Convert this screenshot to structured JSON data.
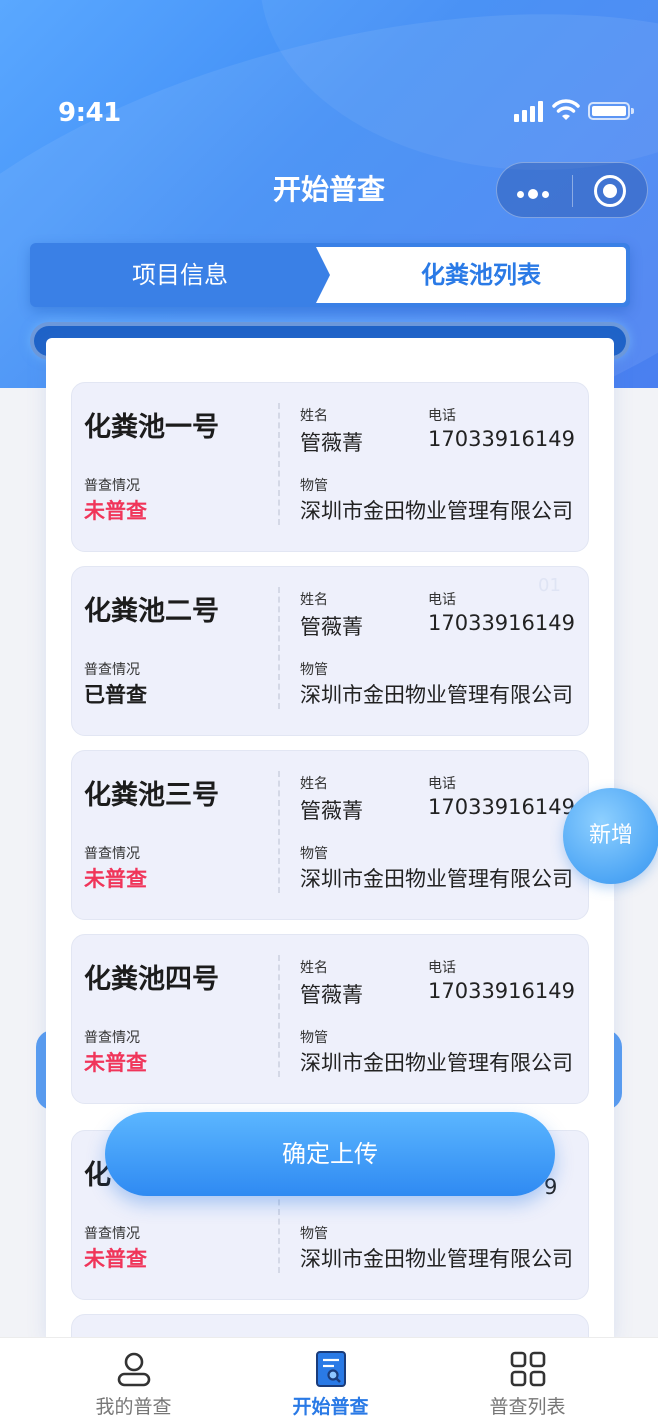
{
  "status_bar": {
    "time": "9:41"
  },
  "header": {
    "title": "开始普查"
  },
  "tabs": [
    {
      "label": "项目信息",
      "active": false
    },
    {
      "label": "化粪池列表",
      "active": true
    }
  ],
  "labels": {
    "status": "普查情况",
    "name": "姓名",
    "phone": "电话",
    "property": "物管"
  },
  "cards": [
    {
      "title": "化粪池一号",
      "status": "未普查",
      "name": "管薇菁",
      "phone": "17033916149",
      "property": "深圳市金田物业管理有限公司",
      "index": ""
    },
    {
      "title": "化粪池二号",
      "status": "已普查",
      "name": "管薇菁",
      "phone": "17033916149",
      "property": "深圳市金田物业管理有限公司",
      "index": "01"
    },
    {
      "title": "化粪池三号",
      "status": "未普查",
      "name": "管薇菁",
      "phone": "17033916149",
      "property": "深圳市金田物业管理有限公司",
      "index": ""
    },
    {
      "title": "化粪池四号",
      "status": "未普查",
      "name": "管薇菁",
      "phone": "17033916149",
      "property": "深圳市金田物业管理有限公司",
      "index": ""
    },
    {
      "title": "化",
      "status": "未普查",
      "name": "",
      "phone": "9",
      "property": "深圳市金田物业管理有限公司",
      "index": ""
    }
  ],
  "actions": {
    "upload": "确定上传",
    "add": "新增"
  },
  "bottom_nav": [
    {
      "label": "我的普查",
      "icon": "user-icon"
    },
    {
      "label": "开始普查",
      "icon": "survey-doc-icon"
    },
    {
      "label": "普查列表",
      "icon": "grid-icon"
    }
  ],
  "colors": {
    "accent": "#2a7ae6",
    "pending": "#f0355a",
    "done": "#1c1c1c"
  }
}
